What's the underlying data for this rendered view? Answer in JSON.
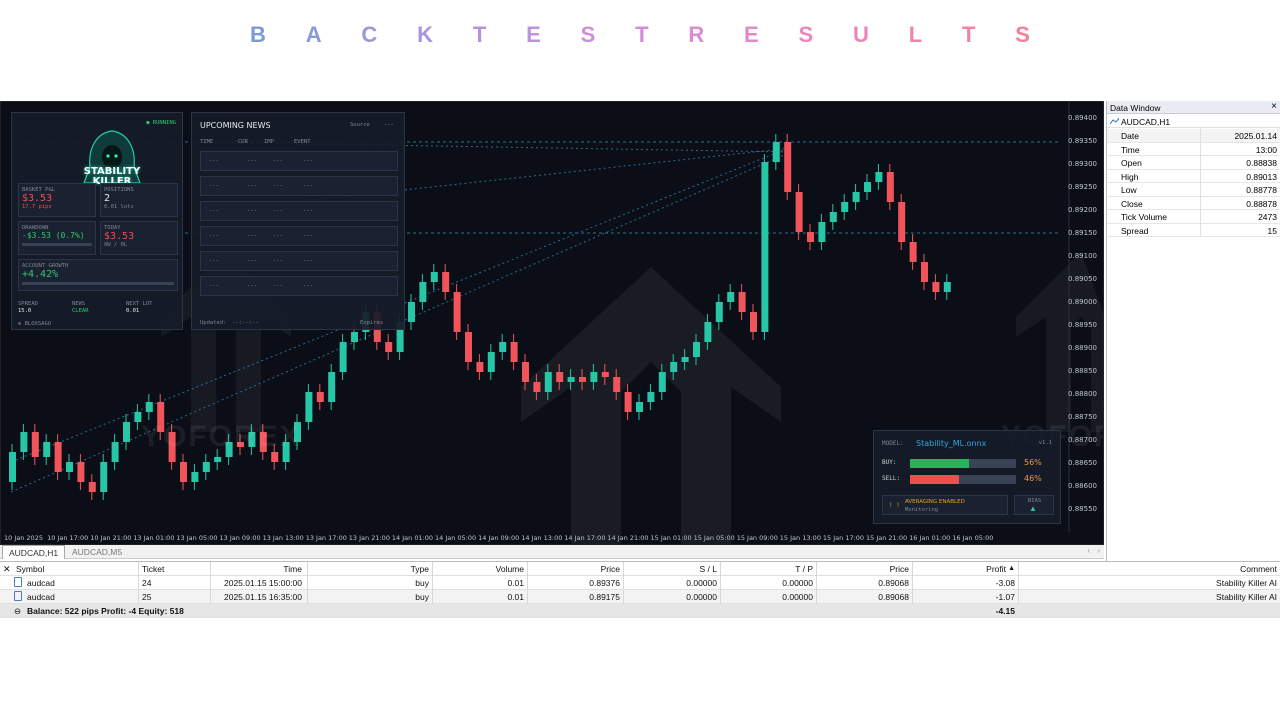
{
  "heading": {
    "letters": [
      "B",
      "A",
      "C",
      "K",
      "T",
      "E",
      "S",
      "T",
      "R",
      "E",
      "S",
      "U",
      "L",
      "T",
      "S"
    ],
    "colors": [
      "#7b9bd6",
      "#8a9ad8",
      "#9a98da",
      "#a896dc",
      "#b493dc",
      "#c191dc",
      "#cc8fda",
      "#d68dd6",
      "#de8bcf",
      "#e489c8",
      "#ea87bf",
      "#ee85b6",
      "#f283ad",
      "#f581a4",
      "#f77f9b"
    ]
  },
  "chart": {
    "price_labels": [
      "0.89400",
      "0.89350",
      "0.89300",
      "0.89250",
      "0.89200",
      "0.89150",
      "0.89100",
      "0.89050",
      "0.89000",
      "0.88950",
      "0.88900",
      "0.88850",
      "0.88800",
      "0.88750",
      "0.88700",
      "0.88650",
      "0.88600",
      "0.88550"
    ],
    "time_labels": [
      "10 Jan 2025",
      "10 Jan 17:00",
      "10 Jan 21:00",
      "13 Jan 01:00",
      "13 Jan 05:00",
      "13 Jan 09:00",
      "13 Jan 13:00",
      "13 Jan 17:00",
      "13 Jan 21:00",
      "14 Jan 01:00",
      "14 Jan 05:00",
      "14 Jan 09:00",
      "14 Jan 13:00",
      "14 Jan 17:00",
      "14 Jan 21:00",
      "15 Jan 01:00",
      "15 Jan 05:00",
      "15 Jan 09:00",
      "15 Jan 13:00",
      "15 Jan 17:00",
      "15 Jan 21:00",
      "16 Jan 01:00",
      "16 Jan 05:00"
    ],
    "bull_color": "#26c6a6",
    "bear_color": "#f2545b",
    "watermarks": [
      "YOFOREX",
      "YOFOREX"
    ]
  },
  "dashboard": {
    "status": "● RUNNING",
    "logo_text": "STABILITY KILLER",
    "basket_label": "BASKET P&L",
    "basket_value": "$3.53",
    "basket_sub": "17.7 pips",
    "positions_label": "POSITIONS",
    "positions_value": "2",
    "positions_sub": "0.01 lots",
    "drawdown_label": "DRAWDOWN",
    "drawdown_value": "-$3.53 (0.7%)",
    "today_label": "TODAY",
    "today_value": "$3.53",
    "today_sub": "0W / 0L",
    "growth_label": "ACCOUNT GROWTH",
    "growth_value": "+4.42%",
    "spread_label": "SPREAD",
    "spread_value": "15.0",
    "news_label": "NEWS",
    "news_value": "CLEAR",
    "next_label": "NEXT LOT",
    "next_value": "0.01",
    "footer": "⊕ BLOXSAGO"
  },
  "news": {
    "title": "UPCOMING NEWS",
    "source_label": "Source",
    "source_value": "---",
    "cols": [
      "TIME",
      "CUR",
      "IMP",
      "EVENT"
    ],
    "placeholder": "---",
    "updated_label": "Updated:",
    "updated_value": "--:--:--",
    "footer_label": "Expires"
  },
  "model": {
    "label": "MODEL:",
    "name": "Stability_ML.onnx",
    "tag": "v1.1",
    "buy_label": "BUY:",
    "buy_pct": "56%",
    "buy_value": 56,
    "sell_label": "SELL:",
    "sell_pct": "46%",
    "sell_value": 46,
    "warn_icon": "! !",
    "warn_title": "AVERAGING ENABLED",
    "warn_sub": "Monitoring",
    "bias_label": "BIAS",
    "bias_icon": "▲"
  },
  "tabs": [
    "AUDCAD,H1",
    "AUDCAD,M5"
  ],
  "data_window": {
    "title": "Data Window",
    "symbol": "AUDCAD,H1",
    "rows": [
      {
        "k": "Date",
        "v": "2025.01.14"
      },
      {
        "k": "Time",
        "v": "13:00"
      },
      {
        "k": "Open",
        "v": "0.88838"
      },
      {
        "k": "High",
        "v": "0.89013"
      },
      {
        "k": "Low",
        "v": "0.88778"
      },
      {
        "k": "Close",
        "v": "0.88878"
      },
      {
        "k": "Tick Volume",
        "v": "2473"
      },
      {
        "k": "Spread",
        "v": "15"
      }
    ]
  },
  "table": {
    "headers": {
      "symbol": "Symbol",
      "ticket": "Ticket",
      "time": "Time",
      "type": "Type",
      "volume": "Volume",
      "price": "Price",
      "sl": "S / L",
      "tp": "T / P",
      "price2": "Price",
      "profit": "Profit",
      "comment": "Comment"
    },
    "rows": [
      {
        "symbol": "audcad",
        "ticket": "24",
        "time": "2025.01.15 15:00:00",
        "type": "buy",
        "volume": "0.01",
        "price": "0.89376",
        "sl": "0.00000",
        "tp": "0.00000",
        "price2": "0.89068",
        "profit": "-3.08",
        "comment": "Stability Killer AI"
      },
      {
        "symbol": "audcad",
        "ticket": "25",
        "time": "2025.01.15 16:35:00",
        "type": "buy",
        "volume": "0.01",
        "price": "0.89175",
        "sl": "0.00000",
        "tp": "0.00000",
        "price2": "0.89068",
        "profit": "-1.07",
        "comment": "Stability Killer AI"
      }
    ],
    "summary": "Balance: 522 pips   Profit: -4   Equity: 518",
    "summary_profit": "-4.15"
  }
}
